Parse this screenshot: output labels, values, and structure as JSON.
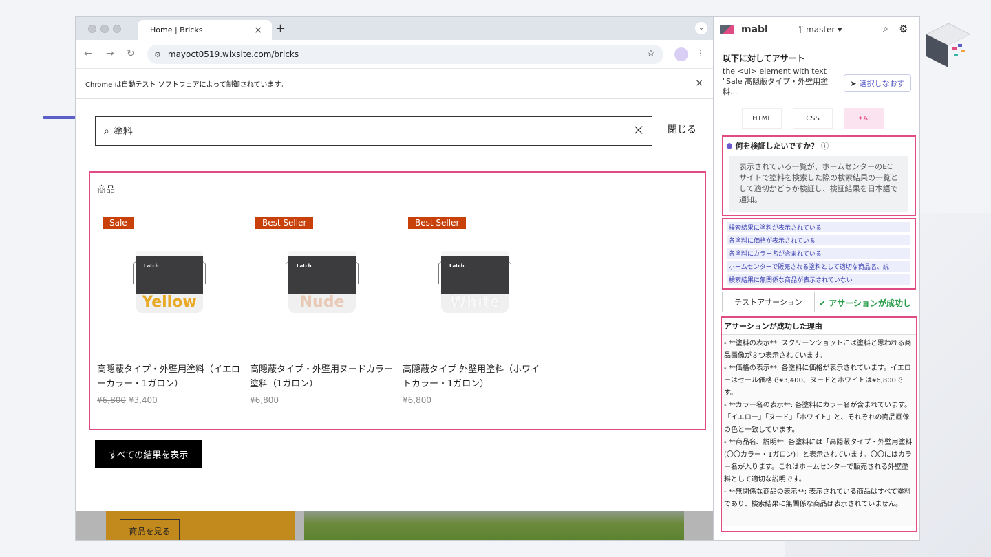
{
  "browser": {
    "tab_title": "Home | Bricks",
    "url": "mayoct0519.wixsite.com/bricks",
    "automation_notice": "Chrome は自動テスト ソフトウェアによって制御されています。"
  },
  "page": {
    "search_value": "塗料",
    "close_label": "閉じる",
    "products_heading": "商品",
    "products": [
      {
        "badge": "Sale",
        "badge_color": "#c8410a",
        "color_word": "Yellow",
        "color_hex": "#e8a924",
        "title": "高隠蔽タイプ・外壁用塗料（イエローカラー・1ガロン）",
        "old_price": "¥6,800",
        "price": "¥3,400"
      },
      {
        "badge": "Best Seller",
        "badge_color": "#c8410a",
        "color_word": "Nude",
        "color_hex": "#e8c9b5",
        "title": "高隠蔽タイプ・外壁用ヌードカラー塗料（1ガロン）",
        "old_price": "",
        "price": "¥6,800"
      },
      {
        "badge": "Best Seller",
        "badge_color": "#c8410a",
        "color_word": "White",
        "color_hex": "#f7f7f7",
        "title": "高隠蔽タイプ 外壁用塗料（ホワイトカラー・1ガロン）",
        "old_price": "",
        "price": "¥6,800"
      }
    ],
    "all_results_label": "すべての結果を表示",
    "view_products_label": "商品を見る"
  },
  "mabl": {
    "name": "mabl",
    "branch": "master",
    "assert_title": "以下に対してアサート",
    "assert_desc": "the <ul> element with text \"Sale 高隠蔽タイプ・外壁用塗料...",
    "reselect_label": "選択しなおす",
    "tabs": [
      "HTML",
      "CSS",
      "AI"
    ],
    "question_label": "何を検証したいですか？",
    "question_text": "表示されている一覧が、ホームセンターのECサイトで塗料を検索した際の検索結果の一覧として適切かどうか検証し、検証結果を日本語で通知。",
    "checks": [
      "検索結果に塗料が表示されている",
      "各塗料に価格が表示されている",
      "各塗料にカラー名が含まれている",
      "ホームセンターで販売される塗料として適切な商品名、説",
      "検索結果に無関係な商品が表示されていない"
    ],
    "test_button": "テストアサーション",
    "success_text": "アサーションが成功し",
    "reason_title": "アサーションが成功した理由",
    "reason_lines": [
      "- **塗料の表示**: スクリーンショットには塗料と思われる商品画像が３つ表示されています。",
      "- **価格の表示**: 各塗料に価格が表示されています。イエローはセール価格で¥3,400、ヌードとホワイトは¥6,800です。",
      "- **カラー名の表示**: 各塗料にカラー名が含まれています。「イエロー」「ヌード」「ホワイト」と、それぞれの商品画像の色と一致しています。",
      "- **商品名、説明**: 各塗料には「高隠蔽タイプ・外壁用塗料(〇〇カラー・1ガロン)」と表示されています。〇〇にはカラー名が入ります。これはホームセンターで販売される外壁塗料として適切な説明です。",
      "- **無関係な商品の表示**: 表示されている商品はすべて塗料であり、検索結果に無関係な商品は表示されていません。"
    ]
  }
}
